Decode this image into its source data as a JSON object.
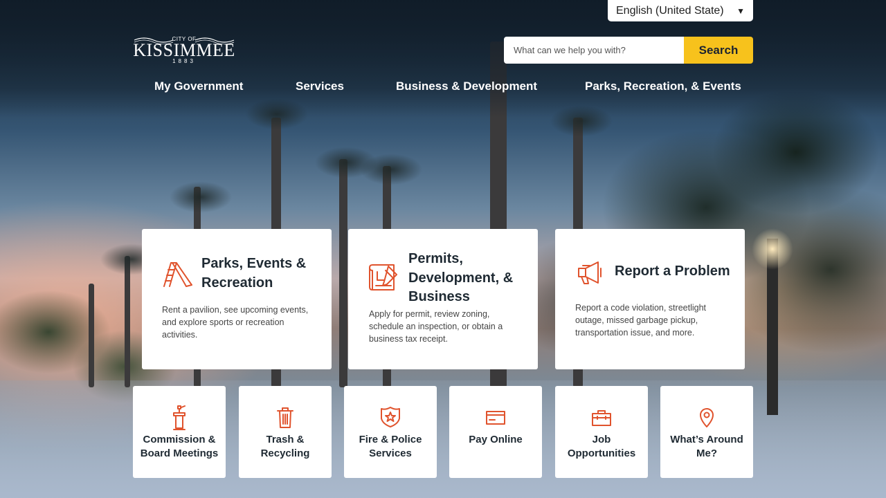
{
  "language": {
    "selected": "English (United State)"
  },
  "logo": {
    "line1": "CITY OF",
    "name": "KISSIMMEE",
    "year": "1883"
  },
  "search": {
    "placeholder": "What can we help you with?",
    "button": "Search"
  },
  "nav": [
    "My Government",
    "Services",
    "Business & Development",
    "Parks, Recreation, & Events"
  ],
  "cards": [
    {
      "icon": "slide-icon",
      "title": "Parks, Events & Recreation",
      "desc": "Rent a pavilion, see upcoming events, and explore sports or recreation activities."
    },
    {
      "icon": "blueprint-icon",
      "title": "Permits, Development, & Business",
      "desc": "Apply for permit, review zoning, schedule an inspection, or obtain a business tax receipt."
    },
    {
      "icon": "megaphone-icon",
      "title": "Report a Problem",
      "desc": "Report a code violation, streetlight outage, missed garbage pickup, transportation issue, and more."
    }
  ],
  "tiles": [
    {
      "icon": "podium-icon",
      "label": "Commission & Board Meetings"
    },
    {
      "icon": "trash-icon",
      "label": "Trash & Recycling"
    },
    {
      "icon": "badge-icon",
      "label": "Fire & Police Services"
    },
    {
      "icon": "credit-card-icon",
      "label": "Pay Online"
    },
    {
      "icon": "briefcase-icon",
      "label": "Job Opportunities"
    },
    {
      "icon": "location-pin-icon",
      "label": "What’s Around Me?"
    }
  ],
  "colors": {
    "accent": "#e0532d",
    "search_button": "#f7c21c",
    "text_dark": "#1f2a33"
  }
}
